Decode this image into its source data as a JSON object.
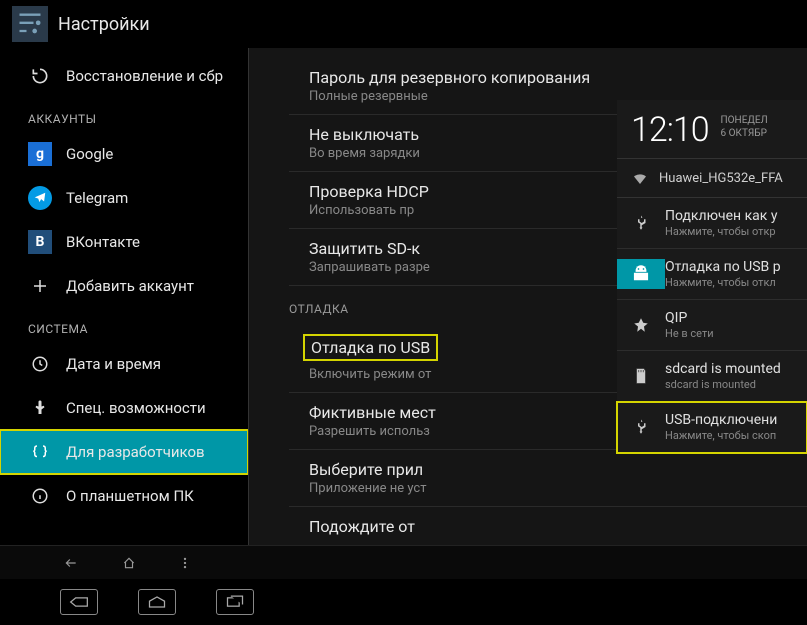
{
  "header": {
    "title": "Настройки"
  },
  "sidebar": {
    "restore": "Восстановление и сбр",
    "section_accounts": "АККАУНТЫ",
    "google": "Google",
    "telegram": "Telegram",
    "vk": "ВКонтакте",
    "add_account": "Добавить аккаунт",
    "section_system": "СИСТЕМА",
    "datetime": "Дата и время",
    "accessibility": "Спец. возможности",
    "developer": "Для разработчиков",
    "about": "О планшетном ПК"
  },
  "main": {
    "backup_pwd": {
      "title": "Пароль для резервного копирования",
      "sub": "Полные резервные"
    },
    "stay_awake": {
      "title": "Не выключать",
      "sub": "Во время зарядки"
    },
    "hdcp": {
      "title": "Проверка HDCP",
      "sub": "Использовать пр"
    },
    "sd": {
      "title": "Защитить SD-к",
      "sub": "Запрашивать разре"
    },
    "section_debug": "ОТЛАДКА",
    "usb_debug": {
      "title": "Отладка по USB",
      "sub": "Включить режим от"
    },
    "mock": {
      "title": "Фиктивные мест",
      "sub": "Разрешить использ"
    },
    "select_app": {
      "title": "Выберите прил",
      "sub": "Приложение не уст"
    },
    "wait": {
      "title": "Подождите от",
      "sub": ""
    }
  },
  "overlay": {
    "time": "12:10",
    "day": "ПОНЕДЕЛ",
    "date": "6 ОКТЯБР",
    "wifi": "Huawei_HG532e_FFA",
    "rows": {
      "connected": {
        "title": "Подключен как у",
        "sub": "Нажмите, чтобы откр"
      },
      "usb_debug": {
        "title": "Отладка по USB р",
        "sub": "Нажмите, чтобы откл"
      },
      "qip": {
        "title": "QIP",
        "sub": "Не в сети"
      },
      "sdcard": {
        "title": "sdcard is mounted",
        "sub": "sdcard is mounted"
      },
      "usb_conn": {
        "title": "USB-подключени",
        "sub": "Нажмите, чтобы скоп"
      }
    }
  }
}
